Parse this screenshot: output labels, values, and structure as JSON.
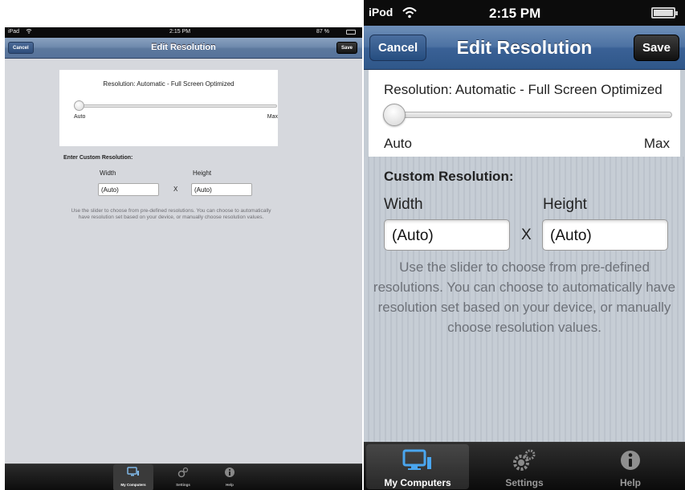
{
  "ipad": {
    "status": {
      "carrier": "iPad",
      "time": "2:15 PM",
      "battery": "87 %"
    },
    "navbar": {
      "title": "Edit Resolution",
      "cancel": "Cancel",
      "save": "Save"
    },
    "resolution": {
      "label": "Resolution: Automatic - Full Screen Optimized",
      "min_label": "Auto",
      "max_label": "Max",
      "slider_value": 0
    },
    "custom": {
      "header": "Enter Custom Resolution:",
      "width_label": "Width",
      "height_label": "Height",
      "width_value": "(Auto)",
      "height_value": "(Auto)",
      "separator": "X"
    },
    "help": "Use the slider to choose from pre-defined resolutions. You can choose to automatically have resolution set based on your device, or manually choose resolution values.",
    "tabs": [
      {
        "label": "My Computers",
        "icon": "monitor-icon",
        "active": true
      },
      {
        "label": "Settings",
        "icon": "gear-icon",
        "active": false
      },
      {
        "label": "Help",
        "icon": "info-icon",
        "active": false
      }
    ]
  },
  "ipod": {
    "status": {
      "carrier": "iPod",
      "time": "2:15 PM"
    },
    "navbar": {
      "title": "Edit Resolution",
      "cancel": "Cancel",
      "save": "Save"
    },
    "resolution": {
      "label": "Resolution: Automatic - Full Screen Optimized",
      "min_label": "Auto",
      "max_label": "Max",
      "slider_value": 0
    },
    "custom": {
      "header": "Custom Resolution:",
      "width_label": "Width",
      "height_label": "Height",
      "width_value": "(Auto)",
      "height_value": "(Auto)",
      "separator": "X"
    },
    "help": "Use the slider to choose from pre-defined resolutions. You can choose to automatically have resolution set based on your device, or manually choose resolution values.",
    "tabs": [
      {
        "label": "My Computers",
        "icon": "monitor-icon",
        "active": true
      },
      {
        "label": "Settings",
        "icon": "gear-icon",
        "active": false
      },
      {
        "label": "Help",
        "icon": "info-icon",
        "active": false
      }
    ]
  },
  "colors": {
    "navbar": "#5c789d",
    "background": "#c5ccd4",
    "help_text": "#6d7178",
    "tabbar": "#111111"
  }
}
